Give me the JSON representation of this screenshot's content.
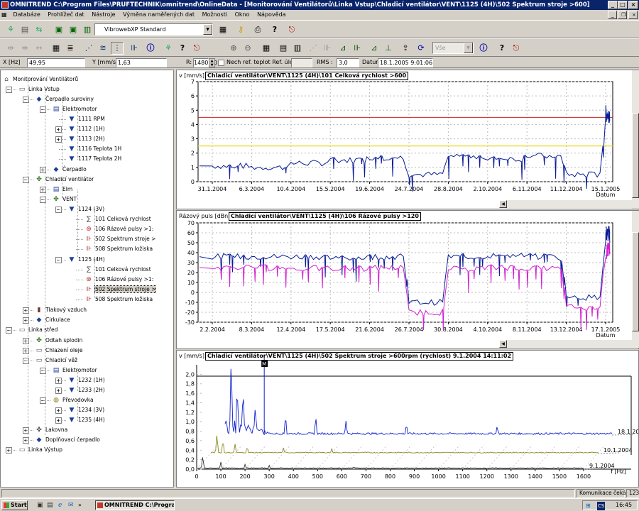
{
  "window": {
    "title": "OMNITREND C:\\Program Files\\PRUFTECHNIK\\omnitrend\\OnlineData - [Monitorování Ventilátorů\\Linka Vstup\\Chladicí ventilátor\\VENT\\1125 (4H)\\502 Spektrum stroje >600]"
  },
  "menu": [
    "Databáze",
    "Prohlížeč dat",
    "Nástroje",
    "Výměna naměřených dat",
    "Možnosti",
    "Okno",
    "Nápověda"
  ],
  "toolbar": {
    "profile_combo": "VibrowebXP  Standard",
    "filter_combo": "Vše"
  },
  "cursor": {
    "x_label": "X [Hz]",
    "x_value": "49,95",
    "y_label": "Y [mm/s]",
    "y_value": "1,63",
    "r_label": "R:",
    "r_value": "1480,00",
    "ref_checkbox": "Nech ref. teplot Ref. úloha",
    "rms_label": "RMS :",
    "rms_value": "3,0",
    "date_label": "Datur",
    "date_value": "18.1.2005 9:01:06"
  },
  "tree": [
    {
      "label": "Monitorování Ventilátorů",
      "icon": "factory-icon"
    },
    {
      "label": "Linka Vstup",
      "icon": "folder-icon"
    },
    {
      "label": "Čerpadlo suroviny",
      "icon": "pump-icon"
    },
    {
      "label": "Elektromotor",
      "icon": "motor-icon"
    },
    {
      "label": "1111 RPM",
      "icon": "sensor-icon"
    },
    {
      "label": "1112 (1H)",
      "icon": "sensor-icon"
    },
    {
      "label": "1113 (2H)",
      "icon": "sensor-icon"
    },
    {
      "label": "1116 Teplota 1H",
      "icon": "sensor-icon"
    },
    {
      "label": "1117 Teplota 2H",
      "icon": "sensor-icon"
    },
    {
      "label": "Čerpadlo",
      "icon": "pump-icon"
    },
    {
      "label": "Chladicí ventilátor",
      "icon": "fan-icon"
    },
    {
      "label": "Elm",
      "icon": "motor-icon"
    },
    {
      "label": "VENT",
      "icon": "fan-icon"
    },
    {
      "label": "1124 (3V)",
      "icon": "sensor-icon"
    },
    {
      "label": "101 Celková rychlost",
      "icon": "overall-icon"
    },
    {
      "label": "106 Rázové pulsy >1:",
      "icon": "shock-icon"
    },
    {
      "label": "502 Spektrum stroje >",
      "icon": "spectrum-icon"
    },
    {
      "label": "508 Spektrum ložiska",
      "icon": "spectrum-icon"
    },
    {
      "label": "1125 (4H)",
      "icon": "sensor-icon"
    },
    {
      "label": "101 Celková rychlost",
      "icon": "overall-icon"
    },
    {
      "label": "106 Rázové pulsy >1:",
      "icon": "shock-icon"
    },
    {
      "label": "502 Spektrum stroje >",
      "icon": "spectrum-icon"
    },
    {
      "label": "508 Spektrum ložiska",
      "icon": "spectrum-icon"
    },
    {
      "label": "Tlakový vzduch",
      "icon": "compressor-icon"
    },
    {
      "label": "Cirkulace",
      "icon": "pump-icon"
    },
    {
      "label": "Linka střed",
      "icon": "folder-icon"
    },
    {
      "label": "Odtah splodin",
      "icon": "fan-icon"
    },
    {
      "label": "Chlazení oleje",
      "icon": "folder-icon"
    },
    {
      "label": "Chladicí věž",
      "icon": "tower-icon"
    },
    {
      "label": "Elektromotor",
      "icon": "motor-icon"
    },
    {
      "label": "1232 (1H)",
      "icon": "sensor-icon"
    },
    {
      "label": "1233 (2H)",
      "icon": "sensor-icon"
    },
    {
      "label": "Převodovka",
      "icon": "gearbox-icon"
    },
    {
      "label": "1234 (3V)",
      "icon": "sensor-icon"
    },
    {
      "label": "1235 (4H)",
      "icon": "sensor-icon"
    },
    {
      "label": "Lakovna",
      "icon": "paint-icon"
    },
    {
      "label": "Doplňovací čerpadlo",
      "icon": "pump-icon"
    },
    {
      "label": "Linka Výstup",
      "icon": "folder-icon"
    }
  ],
  "charts": {
    "trend1": {
      "title": "Chladicí ventilátor\\VENT\\1125 (4H)\\101 Celková rychlost >600",
      "unit": "v [mm/s]",
      "xlabel": "Datum",
      "yticks": [
        "7",
        "6",
        "5",
        "4",
        "3",
        "2",
        "1",
        "0"
      ],
      "xticks": [
        "31.1.2004",
        "6.3.2004",
        "10.4.2004",
        "15.5.2004",
        "19.6.2004",
        "24.7.2004",
        "28.8.2004",
        "2.10.2004",
        "6.11.2004",
        "11.12.2004",
        "15.1.2005"
      ]
    },
    "trend2": {
      "title": "Chladicí ventilátor\\VENT\\1125 (4H)\\106 Rázové pulsy >120",
      "unit": "Rázový puls [dBn]",
      "xlabel": "Datum",
      "yticks": [
        "70",
        "60",
        "50",
        "40",
        "30",
        "20",
        "10",
        "0",
        "-10",
        "-20",
        "-30"
      ],
      "xticks": [
        "2.2.2004",
        "8.3.2004",
        "12.4.2004",
        "17.5.2004",
        "21.6.2004",
        "26.7.2004",
        "30.8.2004",
        "4.10.2004",
        "8.11.2004",
        "13.12.2004",
        "17.1.2005"
      ]
    },
    "spectrum": {
      "title": "Chladicí ventilátor\\VENT\\1125 (4H)\\502 Spektrum stroje >600rpm (rychlost) 9.1.2004 14:11:02",
      "unit": "v [mm/s]",
      "xlabel": "f [Hz]",
      "yticks": [
        "2,0",
        "1,8",
        "1,6",
        "1,4",
        "1,2",
        "1,0",
        "0,8",
        "0,6",
        "0,4",
        "0,2",
        "0,0"
      ],
      "xticks": [
        "0",
        "100",
        "200",
        "300",
        "400",
        "500",
        "600",
        "700",
        "800",
        "900",
        "1000",
        "1100",
        "1200",
        "1300",
        "1400",
        "1500",
        "1600"
      ],
      "traces": [
        "18.1.2005",
        "10.1.2004",
        "9.1.2004"
      ],
      "cursor_marker": "M"
    }
  },
  "chart_data": [
    {
      "type": "line",
      "title": "Chladicí ventilátor\\VENT\\1125 (4H)\\101 Celková rychlost >600",
      "xlabel": "Datum",
      "ylabel": "v [mm/s]",
      "ylim": [
        0,
        7
      ],
      "alarm_levels": [
        4.5,
        2.5
      ],
      "x": [
        "31.1.2004",
        "6.3.2004",
        "10.4.2004",
        "15.5.2004",
        "19.6.2004",
        "24.7.2004",
        "28.8.2004",
        "2.10.2004",
        "6.11.2004",
        "11.12.2004",
        "15.1.2005"
      ],
      "series": [
        {
          "values": [
            1.1,
            1.0,
            1.3,
            1.5,
            1.7,
            0.5,
            1.8,
            1.6,
            1.8,
            0.5,
            4.5
          ]
        }
      ]
    },
    {
      "type": "line",
      "title": "Chladicí ventilátor\\VENT\\1125 (4H)\\106 Rázové pulsy >120",
      "xlabel": "Datum",
      "ylabel": "Rázový puls [dBn]",
      "ylim": [
        -30,
        70
      ],
      "x": [
        "2.2.2004",
        "8.3.2004",
        "12.4.2004",
        "17.5.2004",
        "21.6.2004",
        "26.7.2004",
        "30.8.2004",
        "4.10.2004",
        "8.11.2004",
        "13.12.2004",
        "17.1.2005"
      ],
      "series": [
        {
          "values": [
            36,
            36,
            36,
            35,
            36,
            -10,
            36,
            37,
            36,
            -5,
            55
          ]
        },
        {
          "values": [
            25,
            25,
            24,
            24,
            25,
            -20,
            24,
            25,
            24,
            -15,
            38
          ]
        }
      ]
    },
    {
      "type": "line",
      "title": "Chladicí ventilátor\\VENT\\1125 (4H)\\502 Spektrum stroje >600rpm (rychlost) 9.1.2004 14:11:02",
      "xlabel": "f [Hz]",
      "ylabel": "v [mm/s]",
      "ylim": [
        0,
        2.2
      ],
      "xlim": [
        0,
        1650
      ],
      "series": [
        {
          "name": "18.1.2005",
          "peaks": [
            [
              25,
              1.6
            ],
            [
              50,
              1.0
            ],
            [
              75,
              0.9
            ],
            [
              125,
              0.6
            ],
            [
              250,
              0.45
            ],
            [
              375,
              0.4
            ],
            [
              500,
              0.3
            ],
            [
              750,
              0.25
            ],
            [
              1125,
              0.2
            ]
          ]
        },
        {
          "name": "10.1.2004",
          "peaks": [
            [
              25,
              0.45
            ],
            [
              50,
              0.3
            ],
            [
              100,
              0.2
            ],
            [
              150,
              0.15
            ],
            [
              300,
              0.12
            ],
            [
              500,
              0.1
            ]
          ]
        },
        {
          "name": "9.1.2004",
          "peaks": [
            [
              25,
              0.3
            ],
            [
              100,
              0.15
            ],
            [
              200,
              0.1
            ],
            [
              300,
              0.08
            ],
            [
              650,
              0.06
            ]
          ]
        }
      ]
    }
  ],
  "status": {
    "komunikace": "Komunikace čeká",
    "num": "123"
  },
  "taskbar": {
    "start": "Start",
    "task": "OMNITREND C:\\Progra...",
    "clock": "16:45"
  }
}
